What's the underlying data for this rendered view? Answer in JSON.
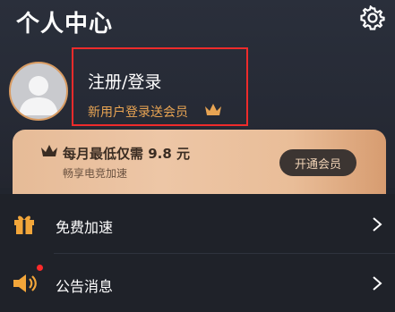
{
  "header": {
    "title": "个人中心",
    "settings_icon": "gear-icon"
  },
  "profile": {
    "avatar_icon": "default-avatar-icon",
    "login_label": "注册/登录",
    "promo_text": "新用户登录送会员",
    "promo_icon": "crown-icon"
  },
  "vip_card": {
    "icon": "crown-icon",
    "title": "每月最低仅需 9.8 元",
    "subtitle": "畅享电竞加速",
    "button_label": "开通会员"
  },
  "menu": {
    "items": [
      {
        "label": "免费加速",
        "icon": "gift-icon",
        "has_badge": false
      },
      {
        "label": "公告消息",
        "icon": "speaker-icon",
        "has_badge": true
      }
    ]
  },
  "colors": {
    "background": "#21252e",
    "accent_orange": "#e8a453",
    "highlight_red": "#ee2b2b",
    "vip_gold": "#e6bb97"
  }
}
